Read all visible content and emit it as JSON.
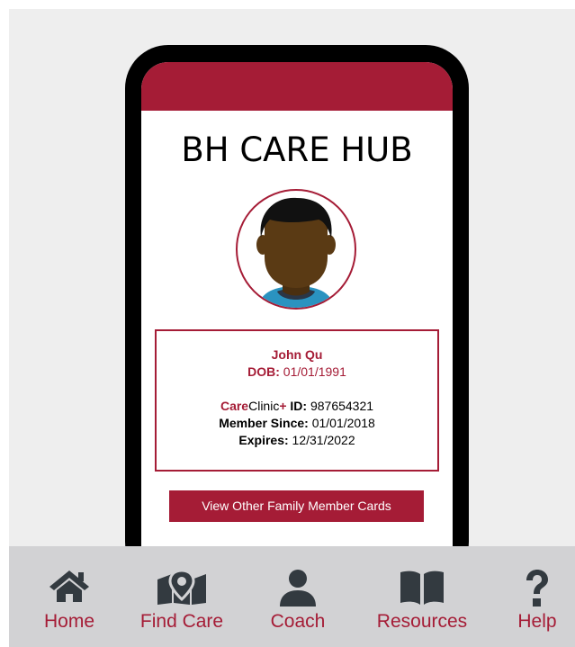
{
  "app": {
    "title": "BH CARE HUB"
  },
  "member": {
    "name": "John Qu",
    "dob_label": "DOB:",
    "dob_value": "01/01/1991",
    "brand_care": "Care",
    "brand_clinic": "Clinic",
    "brand_plus": "+",
    "id_label": "ID:",
    "id_value": "987654321",
    "member_since_label": "Member Since:",
    "member_since_value": "01/01/2018",
    "expires_label": "Expires:",
    "expires_value": "12/31/2022"
  },
  "actions": {
    "family_cards_label": "View Other Family Member Cards"
  },
  "nav": {
    "items": [
      {
        "label": "Home",
        "icon": "home-icon"
      },
      {
        "label": "Find Care",
        "icon": "map-pin-icon"
      },
      {
        "label": "Coach",
        "icon": "person-icon"
      },
      {
        "label": "Resources",
        "icon": "book-icon"
      },
      {
        "label": "Help",
        "icon": "question-icon"
      }
    ]
  },
  "colors": {
    "accent": "#a51c36",
    "nav_icon": "#333a40",
    "nav_bg": "#d2d2d4",
    "skin": "#5a3a14",
    "hair": "#111111",
    "shirt": "#2a93c0"
  }
}
